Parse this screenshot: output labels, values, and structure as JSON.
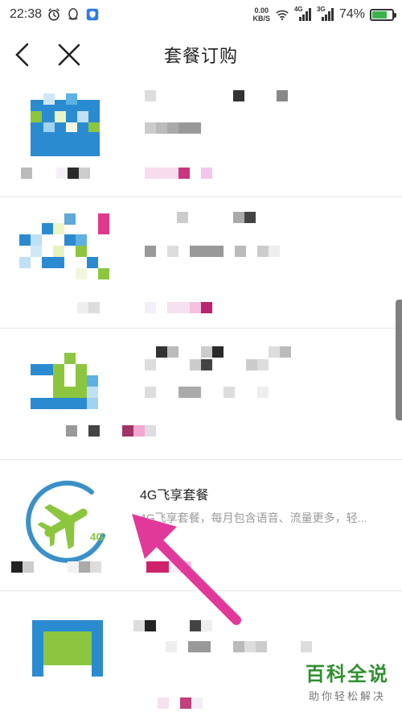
{
  "status_bar": {
    "time": "22:38",
    "net_speed_value": "0.00",
    "net_speed_unit": "KB/S",
    "net1": "4G",
    "net2": "3G",
    "battery": "74%",
    "battery_level": 0.74
  },
  "header": {
    "title": "套餐订购"
  },
  "packages": [
    {
      "name": "",
      "desc": ""
    },
    {
      "name": "",
      "desc": ""
    },
    {
      "name": "",
      "desc": ""
    },
    {
      "name": "4G飞享套餐",
      "desc": "4G飞享套餐，每月包含语音、流量更多，轻...",
      "badge": "4G"
    },
    {
      "name": "",
      "desc": ""
    }
  ],
  "watermark": {
    "title": "百科全说",
    "subtitle": "助你轻松解决"
  },
  "colors": {
    "accent_pink": "#e0399a",
    "green": "#8cc63f",
    "blue": "#2a8bd0"
  }
}
